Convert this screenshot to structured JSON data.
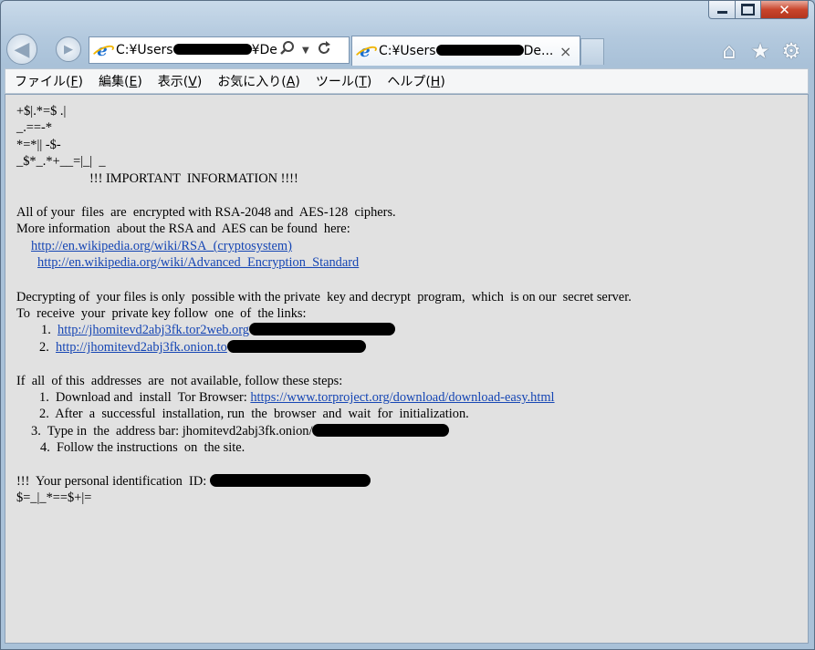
{
  "window": {
    "min_label": "",
    "max_label": "",
    "close_label": "✕"
  },
  "navbar": {
    "back_icon": "◀",
    "forward_icon": "▶",
    "address_text": "C:¥Users",
    "address_tail": "¥De",
    "tab_title": "C:¥Users",
    "tab_title_tail": "De...",
    "tab_close": "×",
    "home_icon": "⌂",
    "star_icon": "★",
    "gear_icon": "⚙"
  },
  "menu": {
    "items": [
      {
        "label": "ファイル(",
        "key": "F",
        "end": ")"
      },
      {
        "label": "編集(",
        "key": "E",
        "end": ")"
      },
      {
        "label": "表示(",
        "key": "V",
        "end": ")"
      },
      {
        "label": "お気に入り(",
        "key": "A",
        "end": ")"
      },
      {
        "label": "ツール(",
        "key": "T",
        "end": ")"
      },
      {
        "label": "ヘルプ(",
        "key": "H",
        "end": ")"
      }
    ]
  },
  "content": {
    "art1": "+$|.*=$ .|",
    "art2": "_.==-*",
    "art3": "*=*|| -$-",
    "art4": "_$*_.*+__=|_|  _",
    "heading": "!!! IMPORTANT  INFORMATION !!!!",
    "p1_line1": "All of your  files  are  encrypted with RSA-2048 and  AES-128  ciphers.",
    "p1_line2": "More information  about the RSA and  AES can be found  here:",
    "link_rsa": "http://en.wikipedia.org/wiki/RSA_(cryptosystem)",
    "link_aes": "http://en.wikipedia.org/wiki/Advanced_Encryption_Standard",
    "p2_line1": "Decrypting of  your files is only  possible with the private  key and decrypt  program,  which  is on our  secret server.",
    "p2_line2": "To  receive  your  private key follow  one  of  the links:",
    "item1_num": "1.",
    "item1_link": "http://jhomitevd2abj3fk.tor2web.org",
    "item2_num": "2.",
    "item2_link": "http://jhomitevd2abj3fk.onion.to",
    "p3_line1": "If  all  of this  addresses  are  not available, follow these steps:",
    "step1_text": "1.  Download and  install  Tor Browser: ",
    "step1_link": "https://www.torproject.org/download/download-easy.html",
    "step2_text": "2.  After  a  successful  installation, run  the  browser  and  wait  for  initialization.",
    "step3_text": "3.  Type in  the  address bar: jhomitevd2abj3fk.onion/",
    "step4_text": "4.  Follow the instructions  on  the site.",
    "id_text": "!!!  Your personal identification  ID: ",
    "art5": "$=_|_*==$+|="
  }
}
